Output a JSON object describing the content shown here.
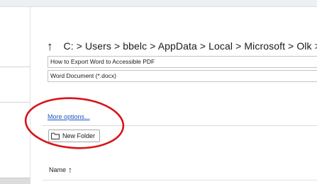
{
  "path": {
    "up_icon": "up-arrow-icon",
    "folder_icon": "folder-icon",
    "text": "C: > Users > bbelc > AppData > Local > Microsoft > Olk > Attac"
  },
  "filename": {
    "value": "How to Export Word to Accessible PDF"
  },
  "save_as_type": {
    "value": "Word Document (*.docx)"
  },
  "more_options": {
    "label": "More options..."
  },
  "new_folder": {
    "label": "New Folder",
    "icon": "folder-icon"
  },
  "columns": {
    "name_label": "Name",
    "sort_icon": "sort-up-arrow-icon"
  },
  "annotation": {
    "color": "#d8131b"
  }
}
